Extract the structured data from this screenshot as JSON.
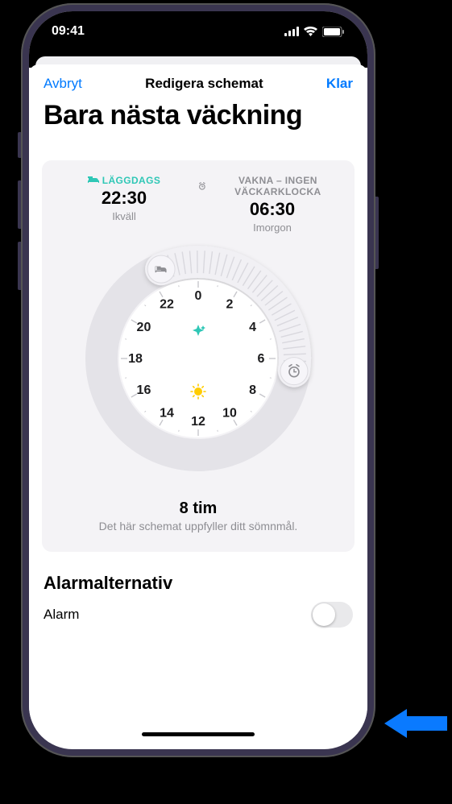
{
  "status": {
    "time": "09:41"
  },
  "sheet": {
    "cancel": "Avbryt",
    "title": "Redigera schemat",
    "done": "Klar"
  },
  "page_title": "Bara nästa väckning",
  "bedtime": {
    "label": "LÄGGDAGS",
    "time": "22:30",
    "sub": "Ikväll"
  },
  "wake": {
    "label": "VAKNA – INGEN VÄCKARKLOCKA",
    "time": "06:30",
    "sub": "Imorgon"
  },
  "dial": {
    "hours": [
      "0",
      "2",
      "4",
      "6",
      "8",
      "10",
      "12",
      "14",
      "16",
      "18",
      "20",
      "22"
    ],
    "start_hour": 22.5,
    "end_hour": 6.5
  },
  "duration": {
    "value": "8 tim",
    "sub": "Det här schemat uppfyller ditt sömnmål."
  },
  "alarm_section": {
    "heading": "Alarmalternativ",
    "row_label": "Alarm",
    "enabled": false
  },
  "colors": {
    "accent": "#007aff",
    "teal": "#2fc7b6"
  }
}
